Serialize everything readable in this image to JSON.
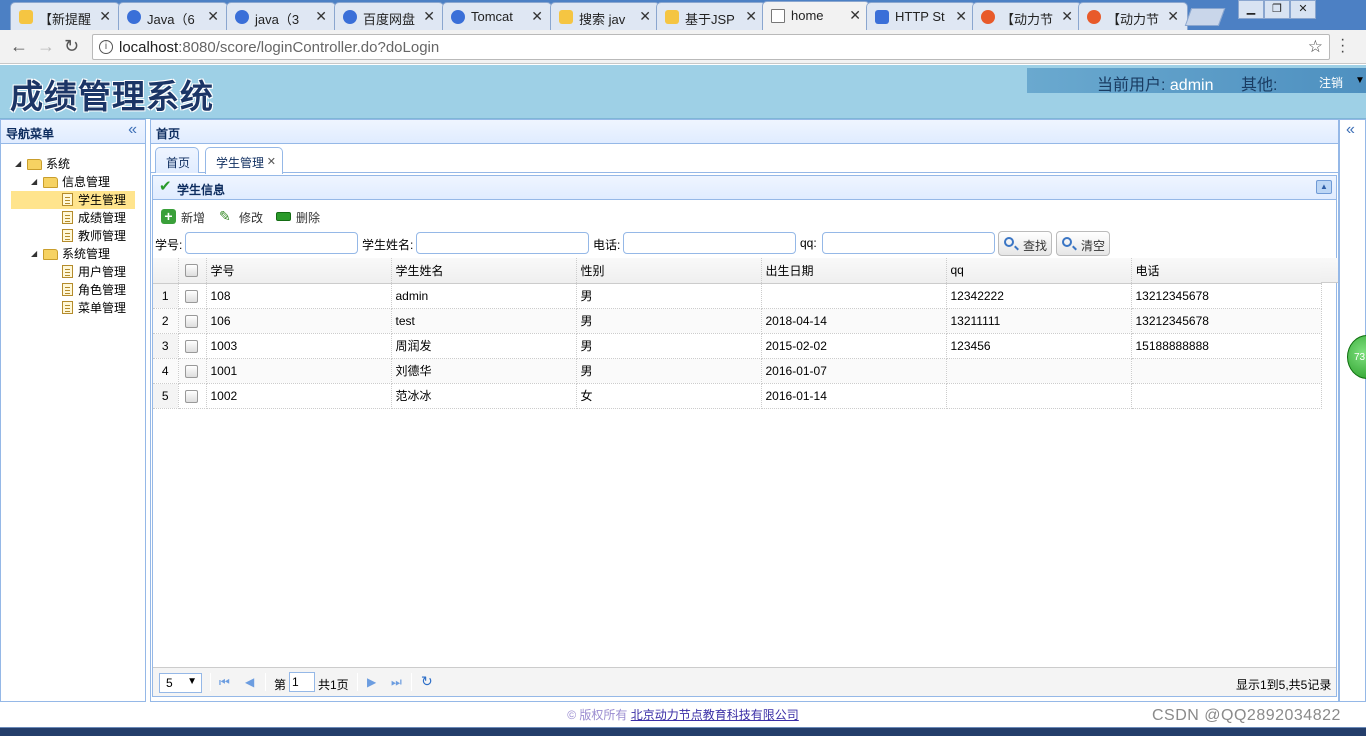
{
  "browser": {
    "tabs": [
      {
        "title": "【新提醒"
      },
      {
        "title": "Java（6"
      },
      {
        "title": "java（3"
      },
      {
        "title": "百度网盘"
      },
      {
        "title": "Tomcat"
      },
      {
        "title": "搜索 jav"
      },
      {
        "title": "基于JSP"
      },
      {
        "title": "home"
      },
      {
        "title": "HTTP St"
      },
      {
        "title": "【动力节"
      },
      {
        "title": "【动力节"
      }
    ],
    "url_host": "localhost",
    "url_path": ":8080/score/loginController.do?doLogin"
  },
  "header": {
    "logo": "成绩管理系统",
    "current_user_label": "当前用户:",
    "current_user": "admin",
    "other_label": "其他:",
    "logout": "注销"
  },
  "sidebar": {
    "title": "导航菜单",
    "tree": [
      {
        "label": "系统"
      },
      {
        "label": "信息管理"
      },
      {
        "label": "学生管理"
      },
      {
        "label": "成绩管理"
      },
      {
        "label": "教师管理"
      },
      {
        "label": "系统管理"
      },
      {
        "label": "用户管理"
      },
      {
        "label": "角色管理"
      },
      {
        "label": "菜单管理"
      }
    ]
  },
  "main": {
    "title": "首页",
    "tabs": [
      {
        "label": "首页"
      },
      {
        "label": "学生管理"
      }
    ],
    "grid_title": "学生信息",
    "toolbar": {
      "add": "新增",
      "edit": "修改",
      "delete": "删除"
    },
    "search": {
      "id_label": "学号:",
      "name_label": "学生姓名:",
      "phone_label": "电话:",
      "qq_label": "qq:",
      "find": "查找",
      "clear": "清空"
    },
    "columns": [
      "学号",
      "学生姓名",
      "性别",
      "出生日期",
      "qq",
      "电话"
    ],
    "rows": [
      {
        "n": "1",
        "id": "108",
        "name": "admin",
        "sex": "男",
        "birth": "",
        "qq": "12342222",
        "phone": "13212345678"
      },
      {
        "n": "2",
        "id": "106",
        "name": "test",
        "sex": "男",
        "birth": "2018-04-14",
        "qq": "13211111",
        "phone": "13212345678"
      },
      {
        "n": "3",
        "id": "1003",
        "name": "周润发",
        "sex": "男",
        "birth": "2015-02-02",
        "qq": "123456",
        "phone": "15188888888"
      },
      {
        "n": "4",
        "id": "1001",
        "name": "刘德华",
        "sex": "男",
        "birth": "2016-01-07",
        "qq": "",
        "phone": ""
      },
      {
        "n": "5",
        "id": "1002",
        "name": "范冰冰",
        "sex": "女",
        "birth": "2016-01-14",
        "qq": "",
        "phone": ""
      }
    ],
    "pager": {
      "page_size": "5",
      "page_prefix": "第",
      "page": "1",
      "total_pages": "共1页",
      "summary": "显示1到5,共5记录"
    }
  },
  "side_widget": "73",
  "footer": {
    "copyright": "© 版权所有",
    "company": "北京动力节点教育科技有限公司"
  },
  "watermark": "CSDN @QQ2892034822"
}
